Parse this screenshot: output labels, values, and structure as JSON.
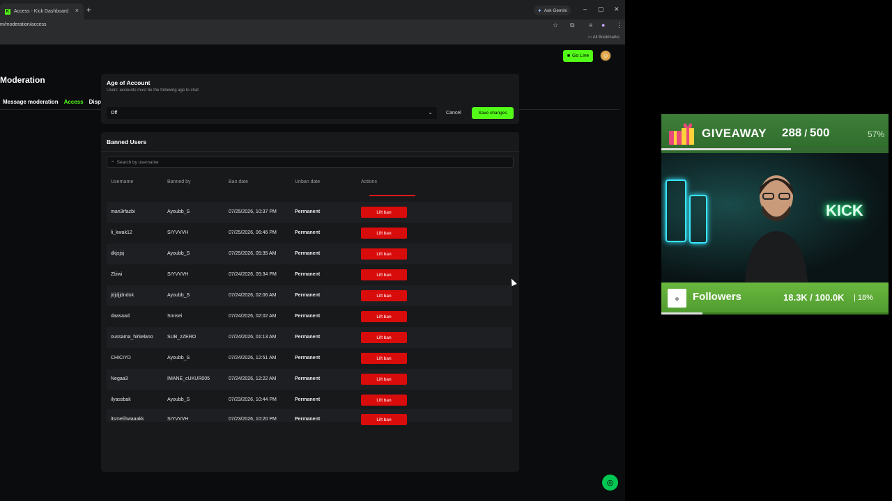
{
  "browser": {
    "tab_title": "Access - Kick Dashboard",
    "tab_close": "×",
    "new_tab": "+",
    "gemini_label": "Ask Gemini",
    "url": "m/moderation/access",
    "all_bookmarks": "All Bookmarks",
    "window_controls": [
      "–",
      "▢",
      "✕"
    ]
  },
  "header": {
    "go_live": "Go Live"
  },
  "page": {
    "title": "Moderation",
    "tabs": [
      {
        "label": "Message moderation",
        "active": false
      },
      {
        "label": "Access",
        "active": true
      },
      {
        "label": "Display",
        "active": false
      }
    ]
  },
  "age_card": {
    "title": "Age of Account",
    "subtitle": "Users' accounts must be the following age to chat",
    "selected": "Off",
    "cancel": "Cancel",
    "save": "Save changes"
  },
  "banned_card": {
    "title": "Banned Users",
    "search_placeholder": "Search by username",
    "columns": [
      "Username",
      "Banned by",
      "Ban date",
      "Unban date",
      "Actions"
    ],
    "lift_label": "Lift ban",
    "rows": [
      {
        "username": "man3rfazbi",
        "banned_by": "Ayoubb_S",
        "ban_date": "07/25/2026, 10:37 PM",
        "unban": "Permanent"
      },
      {
        "username": "li_kwak12",
        "banned_by": "SIYVVVH",
        "ban_date": "07/25/2026, 06:46 PM",
        "unban": "Permanent"
      },
      {
        "username": "dkjsjsj",
        "banned_by": "Ayoubb_S",
        "ban_date": "07/25/2026, 05:35 AM",
        "unban": "Permanent"
      },
      {
        "username": "Zbiwi",
        "banned_by": "SIYVVVH",
        "ban_date": "07/24/2026, 05:34 PM",
        "unban": "Permanent"
      },
      {
        "username": "jdjdjjdndok",
        "banned_by": "Ayoubb_S",
        "ban_date": "07/24/2026, 02:06 AM",
        "unban": "Permanent"
      },
      {
        "username": "daasaad",
        "banned_by": "Snnsei",
        "ban_date": "07/24/2026, 02:02 AM",
        "unban": "Permanent"
      },
      {
        "username": "oussama_hirkelano",
        "banned_by": "SUB_zZERO",
        "ban_date": "07/24/2026, 01:13 AM",
        "unban": "Permanent"
      },
      {
        "username": "CHICIYD",
        "banned_by": "Ayoubb_S",
        "ban_date": "07/24/2026, 12:51 AM",
        "unban": "Permanent"
      },
      {
        "username": "Negaa3",
        "banned_by": "IMANE_cUKUR005",
        "ban_date": "07/24/2026, 12:22 AM",
        "unban": "Permanent"
      },
      {
        "username": "ilyassbak",
        "banned_by": "Ayoubb_S",
        "ban_date": "07/23/2026, 10:44 PM",
        "unban": "Permanent"
      },
      {
        "username": "itsmelihwaaakk",
        "banned_by": "SIYVVVH",
        "ban_date": "07/23/2026, 10:20 PM",
        "unban": "Permanent"
      }
    ]
  },
  "overlay": {
    "giveaway_label": "GIVEAWAY",
    "giveaway_current": "288",
    "giveaway_target": "500",
    "giveaway_percent": "57%",
    "giveaway_fraction": 0.57,
    "neon_sign": "KICK",
    "followers_label": "Followers",
    "followers_count": "18.3K / 100.0K",
    "followers_sep": "|",
    "followers_percent": "18%",
    "followers_fraction": 0.18
  },
  "colors": {
    "brand_green": "#53fc18",
    "danger_red": "#d90c0c",
    "background": "#0b0c0d"
  },
  "icons": [
    "kick-favicon",
    "star-icon",
    "extensions-icon",
    "profile-icon",
    "search-icon",
    "chevron-down-icon",
    "support-chat-icon",
    "gift-icon",
    "user-icon"
  ]
}
